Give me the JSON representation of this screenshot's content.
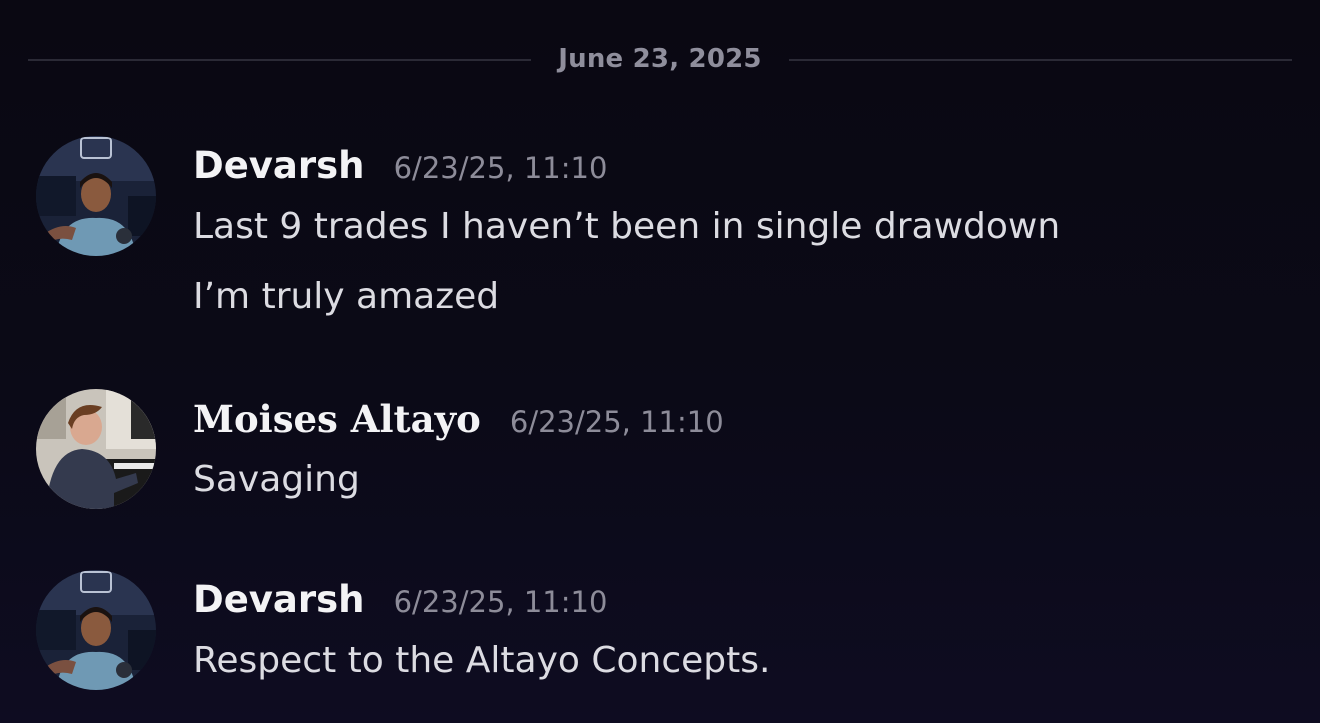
{
  "date_divider": "June 23, 2025",
  "messages": [
    {
      "author": "Devarsh",
      "timestamp": "6/23/25, 11:10",
      "lines": [
        "Last 9 trades I haven’t been in single drawdown",
        "I’m truly amazed"
      ]
    },
    {
      "author": "Moises Altayo",
      "timestamp": "6/23/25, 11:10",
      "lines": [
        "Savaging"
      ]
    },
    {
      "author": "Devarsh",
      "timestamp": "6/23/25, 11:10",
      "lines": [
        "Respect to the Altayo Concepts."
      ]
    }
  ],
  "colors": {
    "background": "#0b0a17",
    "username": "#f3f3f5",
    "timestamp": "#8d8c99",
    "message_text": "#dcdce2",
    "divider": "#2b2a36"
  }
}
